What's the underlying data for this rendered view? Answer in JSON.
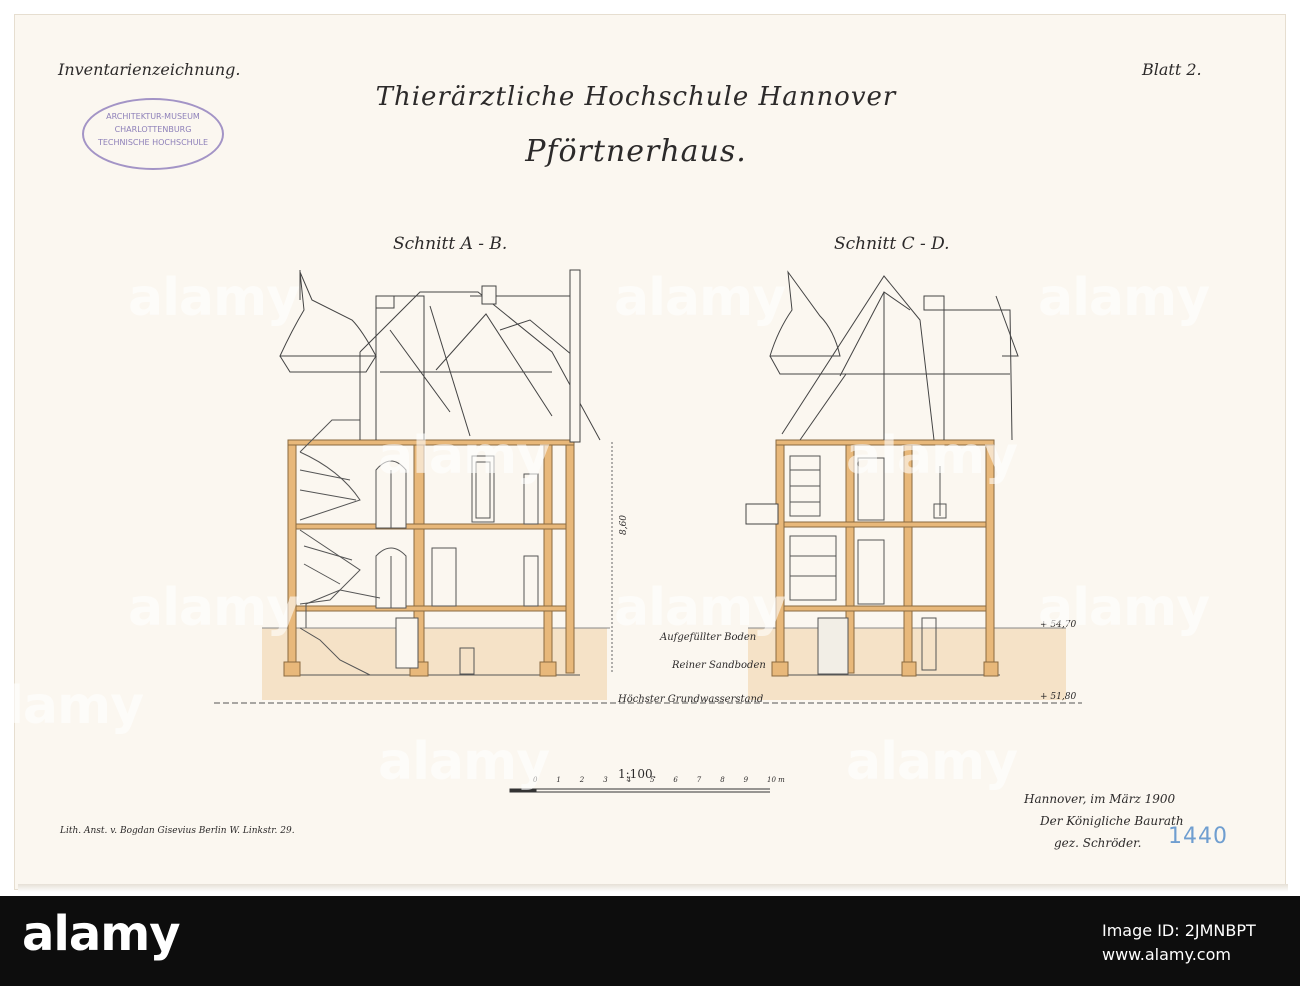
{
  "sheet": {
    "header_left": "Inventarienzeichnung.",
    "header_right": "Blatt 2.",
    "title": "Thierärztliche Hochschule Hannover",
    "subtitle": "Pförtnerhaus.",
    "stamp": {
      "line1": "ARCHITEKTUR-MUSEUM",
      "line2": "CHARLOTTENBURG",
      "line3": "TECHNISCHE HOCHSCHULE",
      "color": "#8e80b9"
    }
  },
  "sections": {
    "left_label": "Schnitt A - B.",
    "right_label": "Schnitt C - D.",
    "fill_label": "Aufgefüllter Boden",
    "sand_label": "Reiner Sandboden",
    "groundwater_label": "Höchster Grundwasserstand",
    "level_upper": "+ 54,70",
    "level_lower": "+ 51,80",
    "height_dim": "8,60",
    "wood_color": "#e8b87a",
    "ground_color": "#f5e2c7"
  },
  "scale": {
    "label": "1:100.",
    "ticks": [
      "0",
      "1",
      "2",
      "3",
      "4",
      "5",
      "6",
      "7",
      "8",
      "9",
      "10 m"
    ]
  },
  "footer_notes": {
    "printer": "Lith. Anst. v. Bogdan Gisevius Berlin W. Linkstr. 29.",
    "place_date": "Hannover, im März 1900",
    "office": "Der Königliche Baurath",
    "signature": "gez. Schröder.",
    "archive_number": "1440"
  },
  "watermark": {
    "brand": "alamy",
    "image_id": "Image ID: 2JMNBPT",
    "url": "www.alamy.com"
  }
}
